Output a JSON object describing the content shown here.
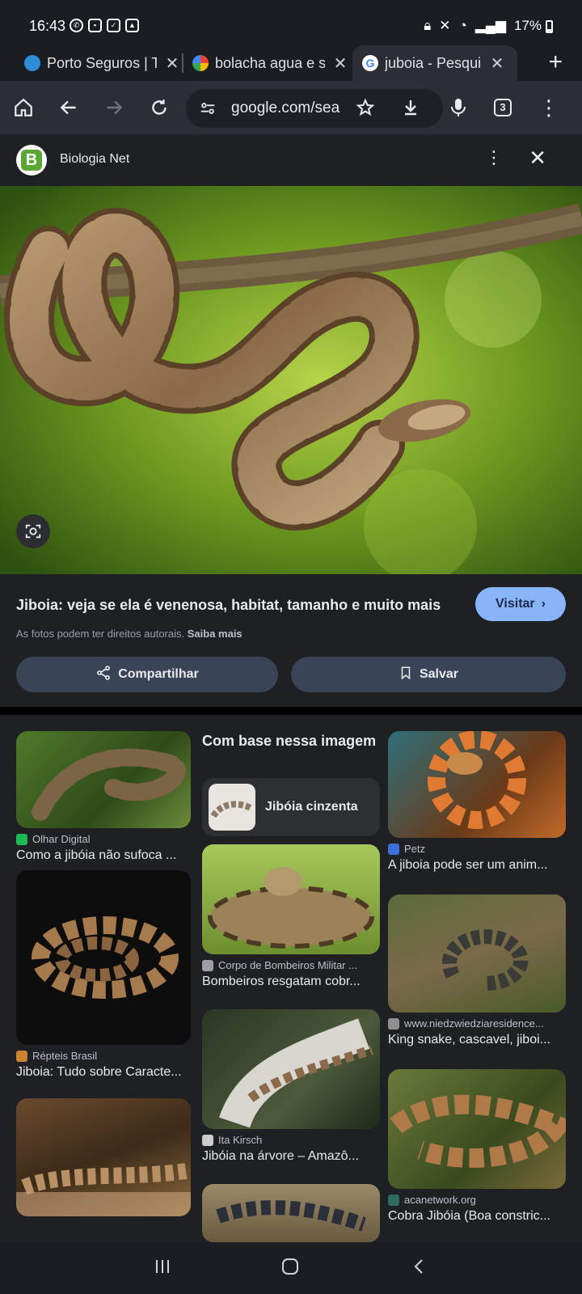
{
  "status": {
    "time": "16:43",
    "left_icons": [
      "whatsapp-icon",
      "notification-icon",
      "check-icon",
      "gallery-icon"
    ],
    "battery": "17%",
    "right_icons": [
      "lock-icon",
      "mute-icon",
      "wifi-icon",
      "volte-icon",
      "signal-icon"
    ]
  },
  "tabs": [
    {
      "title": "Porto Seguros | Tí",
      "favicon_color": "#2f8cd8",
      "active": false
    },
    {
      "title": "bolacha agua e sa",
      "favicon_color": "#e9a23b",
      "active": false
    },
    {
      "title": "juboia - Pesquisa",
      "favicon_color": "#ffffff",
      "active": true
    }
  ],
  "toolbar": {
    "url": "google.com/sea",
    "tab_count": "3"
  },
  "viewer": {
    "source_name": "Biologia Net",
    "source_logo_letter": "B",
    "caption": "Jiboia: veja se ela é venenosa, habitat, tamanho e muito mais",
    "visit_label": "Visitar",
    "rights_text": "As fotos podem ter direitos autorais.",
    "rights_link": "Saiba mais",
    "share_label": "Compartilhar",
    "save_label": "Salvar"
  },
  "related": {
    "based_on": "Com base nessa imagem",
    "chip_label": "Jibóia cinzenta",
    "col1": [
      {
        "source": "Olhar Digital",
        "title": "Como a jibóia não sufoca ...",
        "fav": "#1db954"
      },
      {
        "source": "Répteis Brasil",
        "title": "Jiboia: Tudo sobre Caracte...",
        "fav": "#c9852e"
      },
      {
        "source": "",
        "title": "",
        "fav": ""
      }
    ],
    "col2": [
      {
        "source": "Corpo de Bombeiros Militar ...",
        "title": "Bombeiros resgatam cobr...",
        "fav": "#9aa0a6"
      },
      {
        "source": "Ita Kirsch",
        "title": "Jibóia na árvore – Amazô...",
        "fav": "#cccccc"
      },
      {
        "source": "",
        "title": "",
        "fav": ""
      }
    ],
    "col3": [
      {
        "source": "Petz",
        "title": "A jiboia pode ser um anim...",
        "fav": "#3a6fd8"
      },
      {
        "source": "www.niedzwiedziaresidence...",
        "title": "King snake, cascavel, jiboi...",
        "fav": "#8f8f8f"
      },
      {
        "source": "acanetwork.org",
        "title": "Cobra Jibóia (Boa constric...",
        "fav": "#2e6b5e"
      }
    ]
  }
}
